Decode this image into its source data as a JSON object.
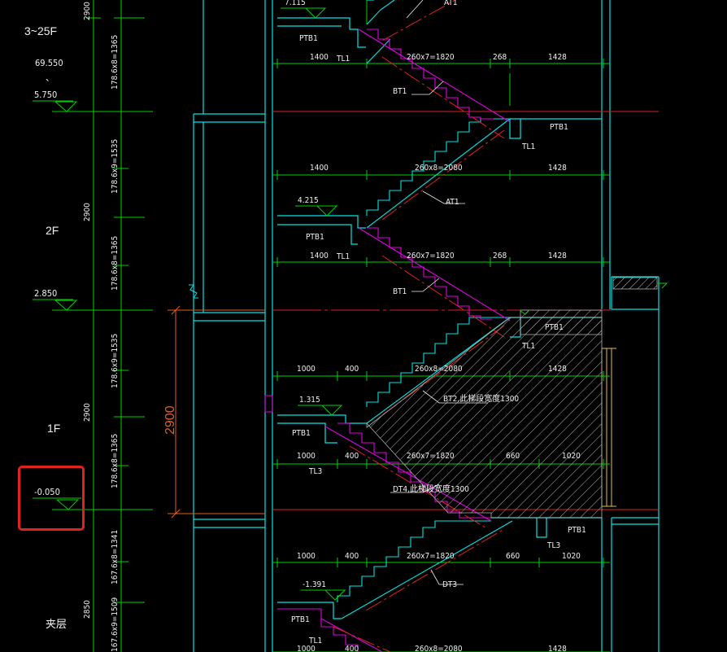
{
  "floors": {
    "label_3_25F": "3~25F",
    "label_2F": "2F",
    "label_1F": "1F",
    "label_mezz": "夹层"
  },
  "elevations": {
    "el_69550": "69.550",
    "el_sep": "、",
    "el_5750": "5.750",
    "el_2850": "2.850",
    "el_m0050": "-0.050"
  },
  "storey_heights": {
    "h_top": "2900",
    "h_2F": "2900",
    "h_1F": "2900",
    "h_mezz": "2850",
    "h_1F_big": "2900"
  },
  "riser_dims": {
    "r1": "178.6x8=1365",
    "r2": "178.6x9=1535",
    "r3": "178.6x8=1365",
    "r4": "178.6x9=1535",
    "r5": "178.6x8=1365",
    "r6": "167.6x8=1341",
    "r7": "167.6x9=1509"
  },
  "stair_levels": {
    "lv_top": "7.115",
    "lv_4215": "4.215",
    "lv_1315": "1.315",
    "lv_m1391": "-1.391"
  },
  "components": {
    "ptb1": "PTB1",
    "tl1": "TL1",
    "tl3": "TL3",
    "at1": "AT1",
    "bt1": "BT1",
    "bt2": "BT2,此梯段宽度1300",
    "dt4": "DT4,此梯段宽度1300",
    "dt3": "DT3"
  },
  "dims": {
    "d1400": "1400",
    "d1000": "1000",
    "d400": "400",
    "d268": "268",
    "d1428": "1428",
    "d660": "660",
    "d1020": "1020",
    "s_260x7": "260x7=1820",
    "s_260x8": "260x8=2080"
  },
  "colors": {
    "background": "#000000",
    "structure_cyan": "#00e5e5",
    "dimension_green": "#00d000",
    "stair_magenta": "#e000e0",
    "centerline_red": "#e02020",
    "text_white": "#f0f0f0",
    "annotation_orange": "#e06020",
    "hatch_gray": "#b0b0b0",
    "highlight_red": "#e0221e"
  }
}
